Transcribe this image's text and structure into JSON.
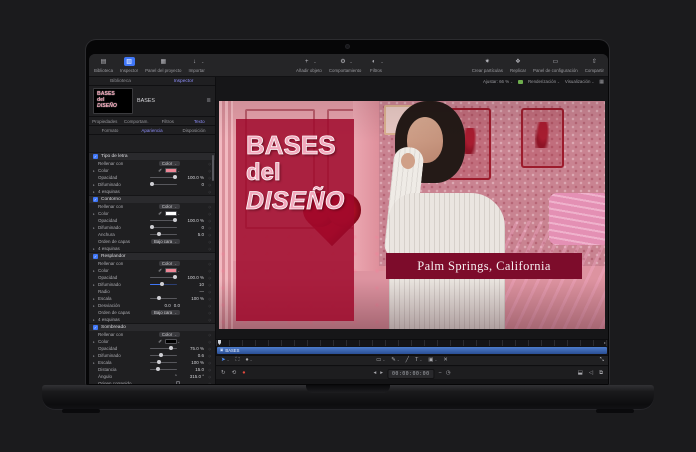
{
  "colors": {
    "accent_blue": "#3f76f7",
    "selection_purple": "#8d8df8",
    "fill_pink": "#ef8696",
    "outline_white": "#ffffff",
    "shadow_black": "#000000",
    "title_pink": "#f2a9bd",
    "banner_red": "#7d0c2b",
    "layer_bar_blue": "#3a62ae",
    "record_red": "#e0493d"
  },
  "toolbar": {
    "groups": [
      {
        "items": [
          {
            "name": "library",
            "glyph": "▤",
            "label": "Biblioteca"
          },
          {
            "name": "inspector",
            "glyph": "▥",
            "label": "Inspector",
            "selected": true
          },
          {
            "name": "project-panel",
            "glyph": "▦",
            "label": "Panel del proyecto"
          },
          {
            "name": "import",
            "glyph": "↓",
            "label": "Importar",
            "dropdown": true
          }
        ]
      },
      {
        "items": [
          {
            "name": "add-object",
            "glyph": "+",
            "label": "Añadir objeto",
            "dropdown": true
          },
          {
            "name": "behavior",
            "glyph": "⚙",
            "label": "Comportamiento",
            "dropdown": true
          },
          {
            "name": "filters",
            "glyph": "◐",
            "label": "Filtros",
            "dropdown": true
          }
        ]
      },
      {
        "items": [
          {
            "name": "make-particles",
            "glyph": "✷",
            "label": "Crear partículas"
          },
          {
            "name": "replicate",
            "glyph": "❖",
            "label": "Replicar"
          },
          {
            "name": "hud",
            "glyph": "▭",
            "label": "Panel de configuración"
          },
          {
            "name": "share",
            "glyph": "⇧",
            "label": "Compartir"
          }
        ]
      }
    ]
  },
  "panel": {
    "top_tabs": [
      {
        "label": "Biblioteca",
        "active": false
      },
      {
        "label": "Inspector",
        "active": true
      }
    ],
    "object_name": "BASES",
    "thumb_lines": [
      "BASES",
      "del",
      "DISEÑO"
    ],
    "tabs": [
      {
        "label": "Propiedades",
        "active": false
      },
      {
        "label": "Comportam.",
        "active": false
      },
      {
        "label": "Filtros",
        "active": false
      },
      {
        "label": "Texto",
        "active": true
      }
    ],
    "subtabs": [
      {
        "label": "Formato",
        "active": false
      },
      {
        "label": "Apariencia",
        "active": true
      },
      {
        "label": "Disposición",
        "active": false
      }
    ],
    "sections": [
      {
        "title": "Tipo de letra",
        "checked": true,
        "rows": [
          {
            "label": "Rellenar con",
            "type": "dropdown",
            "value": "Color"
          },
          {
            "label": "Color",
            "disc": true,
            "type": "color",
            "swatch": "#ef8696"
          },
          {
            "label": "Opacidad",
            "type": "slider",
            "pos": 0.92,
            "value": "100.0 %"
          },
          {
            "label": "Difuminado",
            "disc": true,
            "type": "slider",
            "pos": 0.06,
            "value": "0"
          },
          {
            "label": "4 esquinas",
            "disc": true,
            "type": "label",
            "value": ""
          }
        ]
      },
      {
        "title": "Contorno",
        "checked": true,
        "rows": [
          {
            "label": "Rellenar con",
            "type": "dropdown",
            "value": "Color"
          },
          {
            "label": "Color",
            "disc": true,
            "type": "color",
            "swatch": "#ffffff"
          },
          {
            "label": "Opacidad",
            "type": "slider",
            "pos": 0.92,
            "value": "100.0 %"
          },
          {
            "label": "Difuminado",
            "disc": true,
            "type": "slider",
            "pos": 0.06,
            "value": "0"
          },
          {
            "label": "Anchura",
            "type": "slider",
            "pos": 0.32,
            "value": "5.0"
          },
          {
            "label": "Orden de capas",
            "type": "dropdown",
            "value": "Bajo cara"
          },
          {
            "label": "4 esquinas",
            "disc": true,
            "type": "label",
            "value": ""
          }
        ]
      },
      {
        "title": "Resplandor",
        "checked": true,
        "rows": [
          {
            "label": "Rellenar con",
            "type": "dropdown",
            "value": "Color"
          },
          {
            "label": "Color",
            "disc": true,
            "type": "color",
            "swatch": "#ef8696"
          },
          {
            "label": "Opacidad",
            "type": "slider",
            "pos": 0.92,
            "value": "100.0 %"
          },
          {
            "label": "Difuminado",
            "disc": true,
            "type": "slider-blue",
            "pos": 0.45,
            "value": "10"
          },
          {
            "label": "Radio",
            "type": "value",
            "value": "—"
          },
          {
            "label": "Escala",
            "disc": true,
            "type": "slider",
            "pos": 0.35,
            "value": "100 %"
          },
          {
            "label": "Desviación",
            "disc": true,
            "type": "xy",
            "value": "0.0",
            "value2": "0.0"
          },
          {
            "label": "Orden de capas",
            "type": "dropdown",
            "value": "Bajo cara"
          },
          {
            "label": "4 esquinas",
            "disc": true,
            "type": "label",
            "value": ""
          }
        ]
      },
      {
        "title": "Sombreado",
        "checked": true,
        "rows": [
          {
            "label": "Rellenar con",
            "type": "dropdown",
            "value": "Color"
          },
          {
            "label": "Color",
            "disc": true,
            "type": "color",
            "swatch": "#000000"
          },
          {
            "label": "Opacidad",
            "type": "slider",
            "pos": 0.76,
            "value": "75.0 %"
          },
          {
            "label": "Difuminado",
            "disc": true,
            "type": "slider",
            "pos": 0.42,
            "value": "0.6"
          },
          {
            "label": "Escala",
            "disc": true,
            "type": "slider",
            "pos": 0.35,
            "value": "100 %"
          },
          {
            "label": "Distancia",
            "type": "slider",
            "pos": 0.3,
            "value": "15.0"
          },
          {
            "label": "Ángulo",
            "type": "dial",
            "value": "315.0 °"
          },
          {
            "label": "Origen corregido",
            "type": "checkbox",
            "checked": false,
            "value": ""
          }
        ]
      }
    ]
  },
  "canvas": {
    "status": {
      "zoom_label": "Ajustar: 66 %",
      "render_label": "Renderización",
      "view_label": "Visualización"
    },
    "title_lines": [
      "BASES",
      "del",
      "DISEÑO"
    ],
    "caption": "Palm Springs, California"
  },
  "timeline": {
    "layer_name": "BASES",
    "timecode": "00:00:00:00",
    "tools_left": [
      {
        "name": "select-tool",
        "glyph": "➤",
        "color": "blue",
        "dropdown": true
      },
      {
        "name": "transform-tool",
        "glyph": "⛶"
      },
      {
        "name": "fill-tool",
        "glyph": "●",
        "dropdown": true
      }
    ],
    "tools_center": [
      {
        "name": "rectangle-tool",
        "glyph": "▭",
        "dropdown": true
      },
      {
        "name": "bezier-tool",
        "glyph": "✎",
        "dropdown": true
      },
      {
        "name": "line-tool",
        "glyph": "╱"
      },
      {
        "name": "text-tool",
        "glyph": "T",
        "dropdown": true
      },
      {
        "name": "image-tool",
        "glyph": "▣",
        "dropdown": true
      },
      {
        "name": "close-tool",
        "glyph": "✕"
      }
    ],
    "tools_right": [
      {
        "name": "resize-handle",
        "glyph": "⤡"
      }
    ],
    "transport_left": [
      {
        "name": "loop-button",
        "glyph": "↻"
      },
      {
        "name": "cycle-button",
        "glyph": "⟲"
      },
      {
        "name": "record-button",
        "glyph": "●",
        "color": "red"
      }
    ],
    "transport_center": {
      "prev_glyph": "◂",
      "play_glyph": "▸",
      "minus_glyph": "−",
      "stopwatch_glyph": "◷"
    },
    "transport_right": [
      {
        "name": "display-button",
        "glyph": "⬓"
      },
      {
        "name": "audio-button",
        "glyph": "◁"
      },
      {
        "name": "link-button",
        "glyph": "⧉"
      }
    ]
  }
}
